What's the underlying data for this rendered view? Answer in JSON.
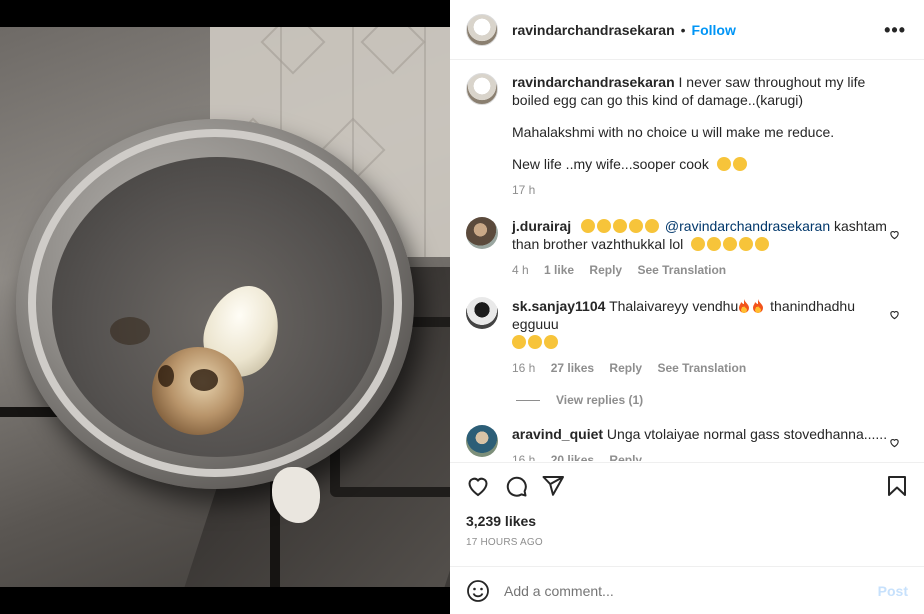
{
  "post": {
    "username": "ravindarchandrasekaran",
    "follow_label": "Follow",
    "dot": "•",
    "more_label": "•••"
  },
  "caption": {
    "username": "ravindarchandrasekaran",
    "line1": "I never saw throughout my life boiled egg can go this kind of damage..(karugi)",
    "line2": "Mahalakshmi with no choice u will make me reduce.",
    "line3": "New life ..my wife...sooper cook",
    "time": "17 h"
  },
  "comments": [
    {
      "username": "j.durairaj",
      "mention": "@ravindarchandrasekaran",
      "text": "kashtam than brother vazhthukkal lol",
      "time": "4 h",
      "likes": "1 like",
      "reply": "Reply",
      "translate": "See Translation"
    },
    {
      "username": "sk.sanjay1104",
      "text_a": "Thalaivareyy vendhu",
      "text_b": "thanindhadhu egguuu",
      "time": "16 h",
      "likes": "27 likes",
      "reply": "Reply",
      "translate": "See Translation",
      "view_replies": "View replies (1)"
    },
    {
      "username": "aravind_quiet",
      "text": "Unga vtolaiyae normal gass stovedhanna......",
      "time": "16 h",
      "likes": "20 likes",
      "reply": "Reply"
    }
  ],
  "stats": {
    "likes": "3,239 likes",
    "timestamp": "17 HOURS AGO"
  },
  "add_comment": {
    "placeholder": "Add a comment...",
    "post_label": "Post"
  },
  "icons": [
    "heart-icon",
    "comment-icon",
    "share-icon",
    "bookmark-icon",
    "emoji-icon",
    "more-icon"
  ]
}
